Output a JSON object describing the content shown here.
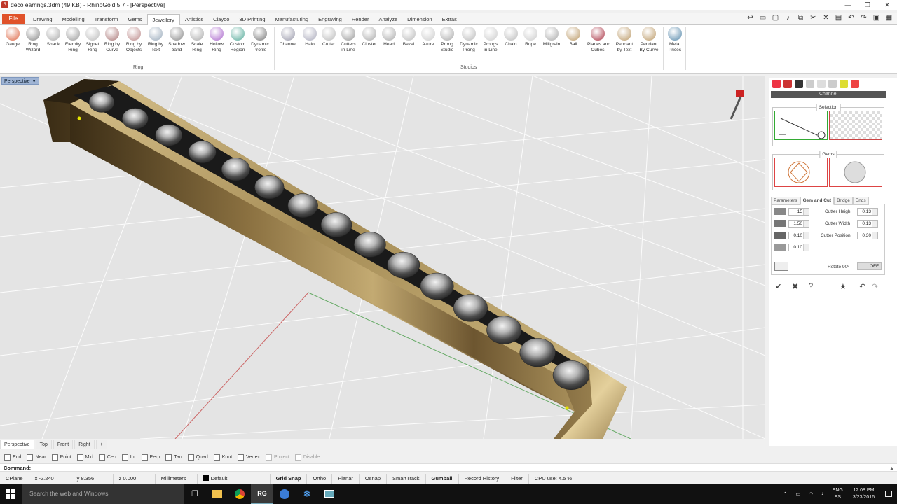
{
  "window": {
    "title": "deco earrings.3dm (49 KB) - RhinoGold 5.7 - [Perspective]",
    "controls": [
      "—",
      "❐",
      "✕"
    ]
  },
  "menu": {
    "file": "File",
    "tabs": [
      "Drawing",
      "Modelling",
      "Transform",
      "Gems",
      "Jewellery",
      "Artistics",
      "Clayoo",
      "3D Printing",
      "Manufacturing",
      "Engraving",
      "Render",
      "Analyze",
      "Dimension",
      "Extras"
    ],
    "active": "Jewellery"
  },
  "ribbon": {
    "ring_group_label": "Ring",
    "studios_group_label": "Studios",
    "ring_tools": [
      {
        "l1": "Gauge",
        "l2": ""
      },
      {
        "l1": "Ring",
        "l2": "Wizard"
      },
      {
        "l1": "Shank",
        "l2": ""
      },
      {
        "l1": "Eternity",
        "l2": "Ring"
      },
      {
        "l1": "Signet",
        "l2": "Ring"
      },
      {
        "l1": "Ring by",
        "l2": "Curve"
      },
      {
        "l1": "Ring by",
        "l2": "Objects"
      },
      {
        "l1": "Ring by",
        "l2": "Text"
      },
      {
        "l1": "Shadow",
        "l2": "band"
      },
      {
        "l1": "Scale",
        "l2": "Ring"
      },
      {
        "l1": "Hollow",
        "l2": "Ring"
      },
      {
        "l1": "Custom",
        "l2": "Region"
      },
      {
        "l1": "Dynamic",
        "l2": "Profile"
      }
    ],
    "studio_tools": [
      {
        "l1": "Channel",
        "l2": ""
      },
      {
        "l1": "Halo",
        "l2": ""
      },
      {
        "l1": "Cutter",
        "l2": ""
      },
      {
        "l1": "Cutters",
        "l2": "in Line"
      },
      {
        "l1": "Cluster",
        "l2": ""
      },
      {
        "l1": "Head",
        "l2": ""
      },
      {
        "l1": "Bezel",
        "l2": ""
      },
      {
        "l1": "Azure",
        "l2": ""
      },
      {
        "l1": "Prong",
        "l2": "Studio"
      },
      {
        "l1": "Dynamic",
        "l2": "Prong"
      },
      {
        "l1": "Prongs",
        "l2": "in Line"
      },
      {
        "l1": "Chain",
        "l2": ""
      },
      {
        "l1": "Rope",
        "l2": ""
      },
      {
        "l1": "Millgrain",
        "l2": ""
      },
      {
        "l1": "Bail",
        "l2": ""
      },
      {
        "l1": "Planes and",
        "l2": "Cubes"
      },
      {
        "l1": "Pendant",
        "l2": "by Text"
      },
      {
        "l1": "Pendant",
        "l2": "By Curve"
      }
    ],
    "metal_tool": {
      "l1": "Metal",
      "l2": "Prices"
    }
  },
  "viewport": {
    "label": "Perspective",
    "tabs": [
      "Perspective",
      "Top",
      "Front",
      "Right"
    ],
    "add_tab": "+",
    "gem_count": 15,
    "colors": {
      "background": "#e4e4e4",
      "gold": "#b8a06a",
      "gem": "#3a3a3a",
      "gem_highlight": "#ececec",
      "grid": "#ffffff"
    }
  },
  "osnaps": {
    "items": [
      {
        "label": "End",
        "dim": false
      },
      {
        "label": "Near",
        "dim": false
      },
      {
        "label": "Point",
        "dim": false
      },
      {
        "label": "Mid",
        "dim": false
      },
      {
        "label": "Cen",
        "dim": false
      },
      {
        "label": "Int",
        "dim": false
      },
      {
        "label": "Perp",
        "dim": false
      },
      {
        "label": "Tan",
        "dim": false
      },
      {
        "label": "Quad",
        "dim": false
      },
      {
        "label": "Knot",
        "dim": false
      },
      {
        "label": "Vertex",
        "dim": false
      },
      {
        "label": "Project",
        "dim": true
      },
      {
        "label": "Disable",
        "dim": true
      }
    ]
  },
  "command": {
    "prompt": "Command:"
  },
  "status": {
    "cplane": "CPlane",
    "x": "x -2.240",
    "y": "y 8.356",
    "z": "z 0.000",
    "units": "Millimeters",
    "layer": "Default",
    "grid_snap": "Grid Snap",
    "ortho": "Ortho",
    "planar": "Planar",
    "osnap": "Osnap",
    "smarttrack": "SmartTrack",
    "gumball": "Gumball",
    "record": "Record History",
    "filter": "Filter",
    "cpu": "CPU use: 4.5 %"
  },
  "panel": {
    "header": "Channel",
    "selection_label": "Selection",
    "gems_label": "Gems",
    "tabs": [
      "Parameters",
      "Gem and Cut",
      "Bridge",
      "Ends"
    ],
    "active_tab": "Gem and Cut",
    "count": "15",
    "p2": "1.50",
    "p3": "0.10",
    "p4": "0.10",
    "cutter_height_label": "Cutter Heigh",
    "cutter_height": "0.13",
    "cutter_width_label": "Cutter Width",
    "cutter_width": "0.13",
    "cutter_position_label": "Cutter Position",
    "cutter_position": "0.30",
    "rotate_label": "Rotate 90º",
    "rotate_state": "OFF"
  },
  "taskbar": {
    "search": "Search the web and Windows",
    "lang1": "ENG",
    "lang2": "ES",
    "time": "12:08 PM",
    "date": "3/23/2016"
  }
}
